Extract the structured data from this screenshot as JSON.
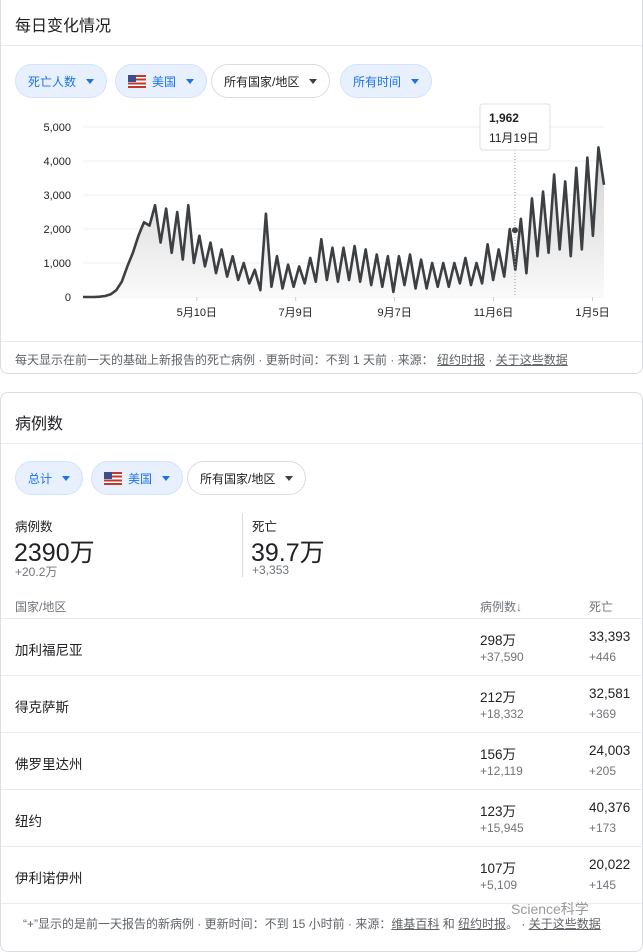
{
  "daily": {
    "title": "每日变化情况",
    "chips": [
      {
        "label": "死亡人数"
      },
      {
        "label": "美国",
        "flag": true
      },
      {
        "label": "所有国家/地区"
      },
      {
        "label": "所有时间"
      }
    ],
    "footer": {
      "text": "每天显示在前一天的基础上新报告的死亡病例 · 更新时间：不到 1 天前 · 来源：",
      "source": "纽约时报",
      "sep": " · ",
      "about": "关于这些数据"
    }
  },
  "chart_data": {
    "type": "area",
    "title": "每日变化情况",
    "ylim": [
      0,
      5000
    ],
    "yticks": [
      0,
      1000,
      2000,
      3000,
      4000,
      5000
    ],
    "ytick_labels": [
      "0",
      "1,000",
      "2,000",
      "3,000",
      "4,000",
      "5,000"
    ],
    "total_days": 316,
    "xticks": [
      {
        "day": 69,
        "label": "5月10日"
      },
      {
        "day": 129,
        "label": "7月9日"
      },
      {
        "day": 189,
        "label": "9月7日"
      },
      {
        "day": 249,
        "label": "11月6日"
      },
      {
        "day": 309,
        "label": "1月5日"
      }
    ],
    "values": [
      0,
      0,
      0,
      10,
      30,
      80,
      200,
      450,
      900,
      1300,
      1800,
      2200,
      2100,
      2700,
      1600,
      2600,
      1300,
      2500,
      1100,
      2700,
      1000,
      1800,
      900,
      1600,
      700,
      1400,
      600,
      1200,
      500,
      1000,
      400,
      800,
      200,
      2450,
      300,
      1200,
      250,
      950,
      300,
      900,
      400,
      1150,
      450,
      1700,
      500,
      1450,
      450,
      1450,
      500,
      1500,
      450,
      1400,
      350,
      1250,
      300,
      1200,
      150,
      1200,
      350,
      1250,
      250,
      1100,
      250,
      1000,
      300,
      1000,
      300,
      1000,
      400,
      1150,
      350,
      1000,
      400,
      1550,
      500,
      1400,
      600,
      2000,
      800,
      2300,
      700,
      2900,
      1200,
      3100,
      1300,
      3600,
      1400,
      3400,
      1200,
      3800,
      1400,
      4100,
      1800,
      4400,
      3300
    ],
    "tooltip": {
      "day": 262,
      "value": 1962,
      "value_label": "1,962",
      "date": "11月19日"
    },
    "grid": true,
    "colors": {
      "line": "#3c4043",
      "fill": "#e0e0e0"
    }
  },
  "cases": {
    "title": "病例数",
    "chips": [
      {
        "label": "总计"
      },
      {
        "label": "美国",
        "flag": true
      },
      {
        "label": "所有国家/地区"
      }
    ],
    "stats": [
      {
        "label": "病例数",
        "value": "2390万",
        "delta": "+20.2万"
      },
      {
        "label": "死亡",
        "value": "39.7万",
        "delta": "+3,353"
      }
    ],
    "headers": {
      "region": "国家/地区",
      "cases": "病例数↓",
      "deaths": "死亡"
    },
    "rows": [
      {
        "name": "加利福尼亚",
        "cases": "298万",
        "cases_delta": "+37,590",
        "deaths": "33,393",
        "deaths_delta": "+446"
      },
      {
        "name": "得克萨斯",
        "cases": "212万",
        "cases_delta": "+18,332",
        "deaths": "32,581",
        "deaths_delta": "+369"
      },
      {
        "name": "佛罗里达州",
        "cases": "156万",
        "cases_delta": "+12,119",
        "deaths": "24,003",
        "deaths_delta": "+205"
      },
      {
        "name": "纽约",
        "cases": "123万",
        "cases_delta": "+15,945",
        "deaths": "40,376",
        "deaths_delta": "+173"
      },
      {
        "name": "伊利诺伊州",
        "cases": "107万",
        "cases_delta": "+5,109",
        "deaths": "20,022",
        "deaths_delta": "+145"
      }
    ],
    "footer": {
      "text": "“+”显示的是前一天报告的新病例 · 更新时间：不到 15 小时前 · 来源：",
      "src1": "维基百科",
      "and": " 和 ",
      "src2": "纽约时报",
      "sep": "。 · ",
      "about": "关于这些数据"
    },
    "watermark": "Science科学"
  }
}
